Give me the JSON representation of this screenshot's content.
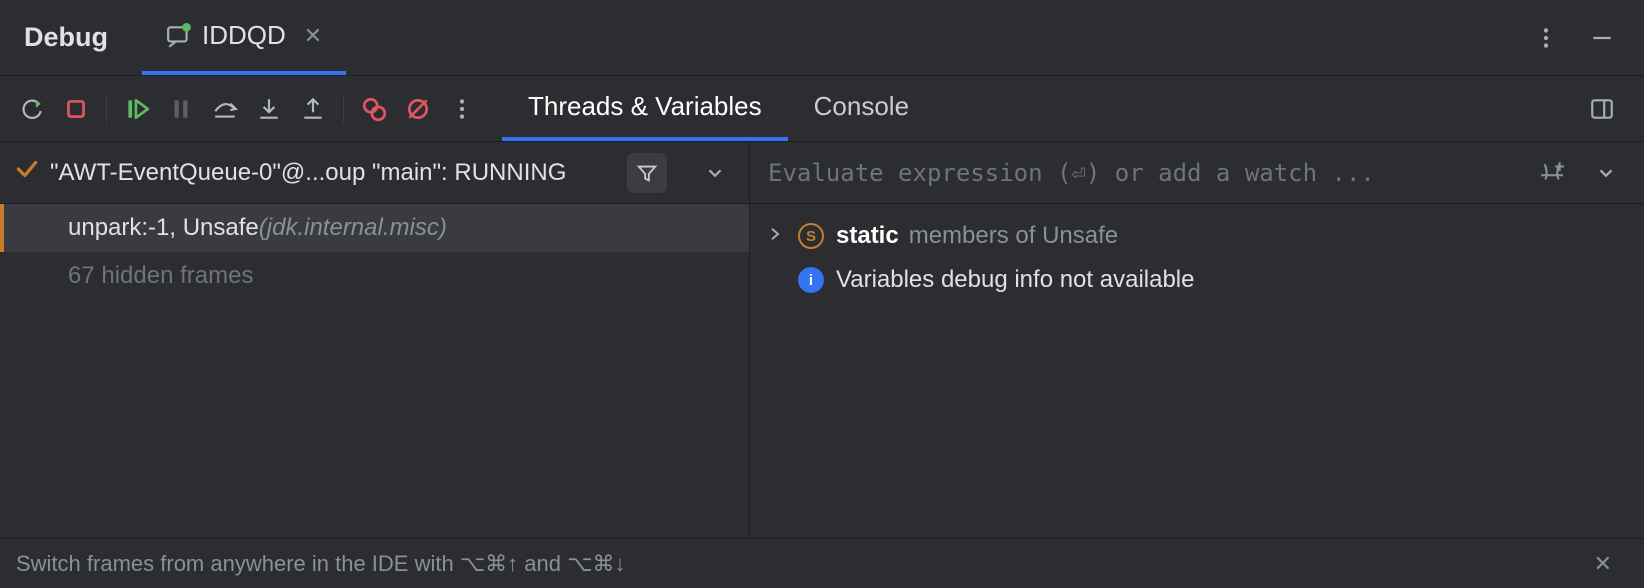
{
  "header": {
    "title": "Debug",
    "run_tab": {
      "label": "IDDQD"
    }
  },
  "toolbar": {
    "rerun_icon": "rerun",
    "stop_icon": "stop",
    "resume_icon": "resume",
    "pause_icon": "pause",
    "step_over_icon": "step-over",
    "step_into_icon": "step-into",
    "step_out_icon": "step-out",
    "view_bp_icon": "view-breakpoints",
    "mute_bp_icon": "mute-breakpoints",
    "more_icon": "more-vertical",
    "layout_icon": "layout"
  },
  "sub_tabs": {
    "threads": "Threads & Variables",
    "console": "Console"
  },
  "thread_header": {
    "text": "\"AWT-EventQueue-0\"@...oup \"main\": RUNNING"
  },
  "frames": {
    "selected": {
      "label": "unpark:-1, Unsafe ",
      "pkg": "(jdk.internal.misc)"
    },
    "hidden_label": "67 hidden frames"
  },
  "eval": {
    "placeholder": "Evaluate expression (⏎) or add a watch ..."
  },
  "variables": {
    "static_prefix": "static",
    "static_suffix": " members of Unsafe",
    "info_text": "Variables debug info not available"
  },
  "hint": {
    "text": "Switch frames from anywhere in the IDE with ⌥⌘↑ and ⌥⌘↓"
  }
}
